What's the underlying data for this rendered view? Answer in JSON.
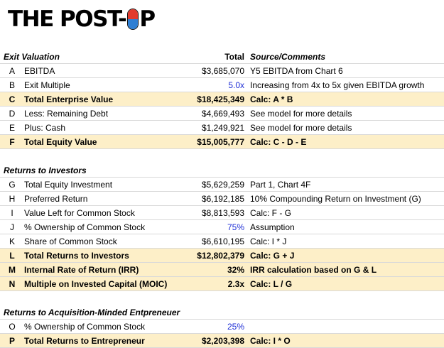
{
  "logo": {
    "left_text": "THE POST-",
    "right_text": "P"
  },
  "exit": {
    "title": "Exit Valuation",
    "total_header": "Total",
    "source_header": "Source/Comments",
    "rows": [
      {
        "letter": "A",
        "label": "EBITDA",
        "value": "$3,685,070",
        "comment": "Y5 EBITDA from Chart 6",
        "highlight": false,
        "blue": false
      },
      {
        "letter": "B",
        "label": "Exit Multiple",
        "value": "5.0x",
        "comment": "Increasing from 4x to 5x given EBITDA growth",
        "highlight": false,
        "blue": true
      },
      {
        "letter": "C",
        "label": "Total Enterprise Value",
        "value": "$18,425,349",
        "comment": "Calc: A * B",
        "highlight": true,
        "blue": false
      },
      {
        "letter": "D",
        "label": "Less: Remaining Debt",
        "value": "$4,669,493",
        "comment": "See model for more details",
        "highlight": false,
        "blue": false
      },
      {
        "letter": "E",
        "label": "Plus: Cash",
        "value": "$1,249,921",
        "comment": "See model for more details",
        "highlight": false,
        "blue": false
      },
      {
        "letter": "F",
        "label": "Total Equity Value",
        "value": "$15,005,777",
        "comment": "Calc: C - D - E",
        "highlight": true,
        "blue": false
      }
    ]
  },
  "investors": {
    "title": "Returns to Investors",
    "rows": [
      {
        "letter": "G",
        "label": "Total Equity Investment",
        "value": "$5,629,259",
        "comment": "Part 1, Chart 4F",
        "highlight": false,
        "blue": false
      },
      {
        "letter": "H",
        "label": "Preferred Return",
        "value": "$6,192,185",
        "comment": "10% Compounding Return on Investment (G)",
        "highlight": false,
        "blue": false
      },
      {
        "letter": "I",
        "label": "Value Left for Common Stock",
        "value": "$8,813,593",
        "comment": "Calc: F - G",
        "highlight": false,
        "blue": false
      },
      {
        "letter": "J",
        "label": "% Ownership of Common Stock",
        "value": "75%",
        "comment": "Assumption",
        "highlight": false,
        "blue": true
      },
      {
        "letter": "K",
        "label": "Share of Common Stock",
        "value": "$6,610,195",
        "comment": "Calc: I * J",
        "highlight": false,
        "blue": false
      },
      {
        "letter": "L",
        "label": "Total Returns to Investors",
        "value": "$12,802,379",
        "comment": "Calc: G + J",
        "highlight": true,
        "blue": false
      },
      {
        "letter": "M",
        "label": "Internal Rate of Return (IRR)",
        "value": "32%",
        "comment": "IRR calculation based on G & L",
        "highlight": true,
        "blue": false
      },
      {
        "letter": "N",
        "label": "Multiple on Invested Capital (MOIC)",
        "value": "2.3x",
        "comment": "Calc: L / G",
        "highlight": true,
        "blue": false
      }
    ]
  },
  "entrepreneur": {
    "title": "Returns to Acquisition-Minded Entpreneuer",
    "rows": [
      {
        "letter": "O",
        "label": "% Ownership of Common Stock",
        "value": "25%",
        "comment": "",
        "highlight": false,
        "blue": true
      },
      {
        "letter": "P",
        "label": "Total Returns to Entrepreneur",
        "value": "$2,203,398",
        "comment": "Calc: I * O",
        "highlight": true,
        "blue": false
      }
    ]
  }
}
